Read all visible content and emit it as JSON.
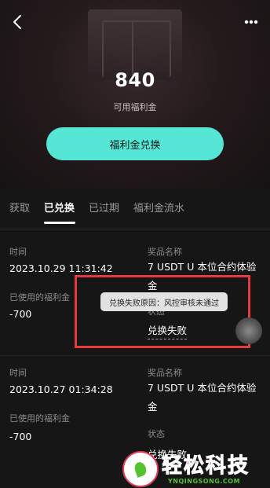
{
  "header": {
    "back_icon": "chevron-left-icon",
    "more_icon": "more-dots-icon"
  },
  "balance": {
    "amount": "840",
    "label": "可用福利金"
  },
  "redeem_button": "福利金兑换",
  "tabs": [
    {
      "label": "获取",
      "active": false
    },
    {
      "label": "已兑换",
      "active": true
    },
    {
      "label": "已过期",
      "active": false
    },
    {
      "label": "福利金流水",
      "active": false
    }
  ],
  "records": [
    {
      "time_label": "时间",
      "time": "2023.10.29 11:31:42",
      "used_label": "已使用的福利金",
      "used": "-700",
      "prize_label": "奖品名称",
      "prize": "7 USDT U 本位合约体验金",
      "status_label": "状态",
      "status": "兑换失败"
    },
    {
      "time_label": "时间",
      "time": "2023.10.27 01:34:28",
      "used_label": "已使用的福利金",
      "used": "-700",
      "prize_label": "奖品名称",
      "prize": "7 USDT U 本位合约体验金",
      "status_label": "状态",
      "status": "兑换失败"
    }
  ],
  "tooltip": "兑换失败原因：风控审核未通过",
  "watermark": {
    "title": "轻松科技",
    "url": "YNQINGSONG.COM"
  },
  "colors": {
    "accent": "#56e6d6",
    "highlight_border": "#e53b3b",
    "background": "#161616"
  }
}
